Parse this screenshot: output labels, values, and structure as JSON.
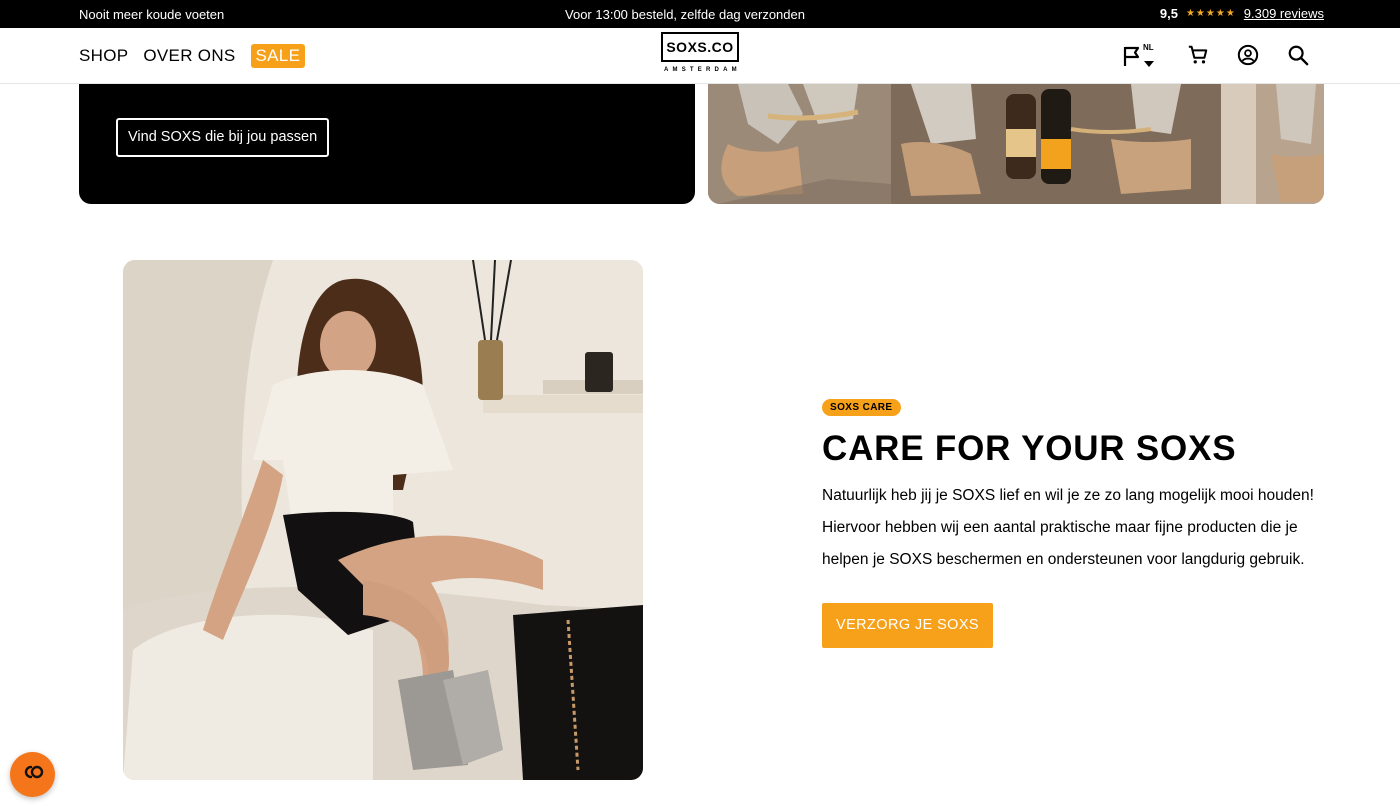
{
  "topbar": {
    "left_text": "Nooit meer koude voeten",
    "center_text": "Voor 13:00 besteld, zelfde dag verzonden",
    "rating_score": "9,5",
    "stars": "★★★★★",
    "reviews_link": "9.309 reviews"
  },
  "header": {
    "nav": {
      "shop": "SHOP",
      "about": "OVER ONS",
      "sale": "SALE"
    },
    "logo": {
      "main": "SOXS.CO",
      "sub": "AMSTERDAM"
    },
    "language_code": "NL"
  },
  "hero": {
    "find_button": "Vind SOXS die bij jou passen"
  },
  "care": {
    "badge": "SOXS CARE",
    "title": "CARE FOR YOUR SOXS",
    "body": "Natuurlijk heb jij je SOXS lief en wil je ze zo lang mogelijk mooi houden! Hiervoor hebben wij een aantal praktische maar fijne producten die je helpen je SOXS beschermen en ondersteunen voor langdurig gebruik.",
    "cta": "VERZORG JE SOXS"
  },
  "colors": {
    "accent": "#f7a11a",
    "fab": "#f5761a",
    "black": "#000000"
  },
  "icons": [
    "flag-icon",
    "cart-icon",
    "account-icon",
    "search-icon",
    "chat-icon"
  ]
}
